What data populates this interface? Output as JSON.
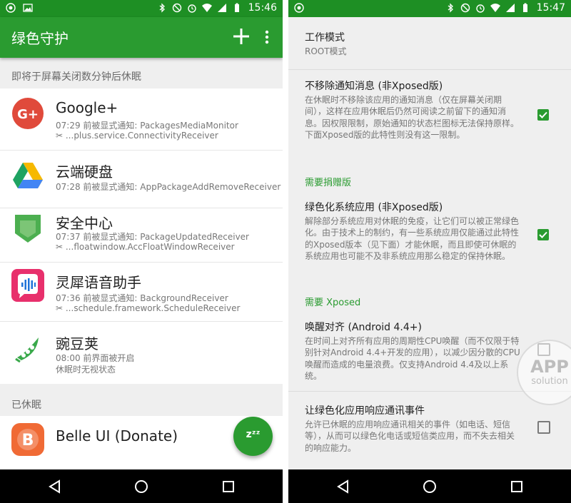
{
  "left": {
    "status": {
      "time": "15:46"
    },
    "appbar": {
      "title": "绿色守护"
    },
    "section1": {
      "header": "即将于屏幕关闭数分钟后休眠"
    },
    "apps": [
      {
        "name": "Google+",
        "line1": "07:29 前被显式通知: PackagesMediaMonitor",
        "line2": "✂ ...plus.service.ConnectivityReceiver"
      },
      {
        "name": "云端硬盘",
        "line1": "07:28 前被显式通知: AppPackageAddRemoveReceiver",
        "line2": ""
      },
      {
        "name": "安全中心",
        "line1": "07:37 前被显式通知: PackageUpdatedReceiver",
        "line2": "✂ ...floatwindow.AccFloatWindowReceiver"
      },
      {
        "name": "灵犀语音助手",
        "line1": "07:36 前被显式通知: BackgroundReceiver",
        "line2": "✂ ...schedule.framework.ScheduleReceiver"
      },
      {
        "name": "豌豆荚",
        "line1": "08:00 前界面被开启",
        "line2": "休眠时无视状态"
      }
    ],
    "section2": {
      "header": "已休眠",
      "apps": [
        {
          "name": "Belle UI (Donate)"
        }
      ]
    },
    "fab_label": "zᶻᶻ"
  },
  "right": {
    "status": {
      "time": "15:47"
    },
    "work_mode": {
      "title": "工作模式",
      "value": "ROOT模式"
    },
    "items": [
      {
        "title": "不移除通知消息 (非Xposed版)",
        "desc": "在休眠时不移除该应用的通知消息（仅在屏幕关闭期间），这样在应用休眠后仍然可阅读之前留下的通知消息。因权限限制，原始通知的状态栏图标无法保持原样。下面Xposed版的此特性则没有这一限制。",
        "checked": true
      },
      {
        "title": "绿色化系统应用 (非Xposed版)",
        "desc": "解除部分系统应用对休眠的免疫，让它们可以被正常绿色化。由于技术上的制约，有一些系统应用仅能通过此特性的Xposed版本（见下面）才能休眠，而且即使可休眠的系统应用也可能不及非系统应用那么稳定的保持休眠。",
        "checked": true
      },
      {
        "title": "唤醒对齐 (Android 4.4+)",
        "desc": "在时间上对齐所有应用的周期性CPU唤醒（而不仅限于特别针对Android 4.4+开发的应用），以减少因分散的CPU唤醒而造成的电量浪费。仅支持Android 4.4及以上系统。",
        "checked": false
      },
      {
        "title": "让绿色化应用响应通讯事件",
        "desc": "允许已休眠的应用响应通讯相关的事件（如电话、短信等），从而可以绿色化电话或短信类应用，而不失去相关的响应能力。",
        "checked": false
      }
    ],
    "groups": {
      "donate": "需要捐赠版",
      "xposed": "需要 Xposed"
    },
    "watermark": {
      "line1": "APP",
      "line2": "solution"
    }
  },
  "colors": {
    "status_bar": "#1e8f24",
    "app_bar": "#2a9b30",
    "accent": "#2a9b30"
  }
}
